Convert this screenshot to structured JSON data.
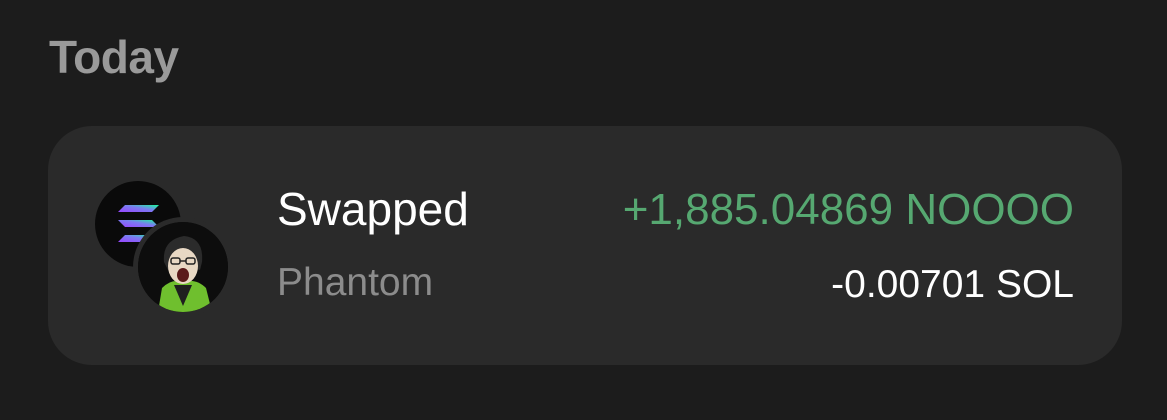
{
  "section": {
    "title": "Today"
  },
  "activity": {
    "title": "Swapped",
    "subtitle": "Phantom",
    "amount_received": "+1,885.04869 NOOOO",
    "amount_sent": "-0.00701 SOL",
    "received_color": "#56a871",
    "icons": {
      "primary": "solana-icon",
      "secondary": "nooooo-token-icon"
    }
  }
}
